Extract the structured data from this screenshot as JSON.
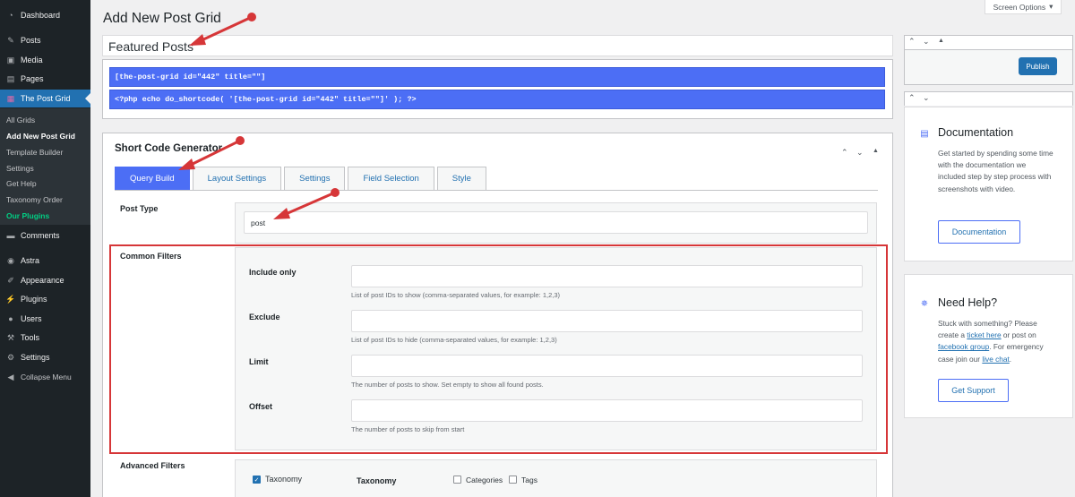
{
  "sidebar": {
    "items": [
      {
        "label": "Dashboard",
        "icon": "dashboard-icon"
      },
      {
        "label": "Posts",
        "icon": "pin-icon"
      },
      {
        "label": "Media",
        "icon": "media-icon"
      },
      {
        "label": "Pages",
        "icon": "page-icon"
      },
      {
        "label": "The Post Grid",
        "icon": "grid-icon"
      },
      {
        "label": "Comments",
        "icon": "comment-icon"
      },
      {
        "label": "Astra",
        "icon": "astra-icon"
      },
      {
        "label": "Appearance",
        "icon": "brush-icon"
      },
      {
        "label": "Plugins",
        "icon": "plug-icon"
      },
      {
        "label": "Users",
        "icon": "user-icon"
      },
      {
        "label": "Tools",
        "icon": "wrench-icon"
      },
      {
        "label": "Settings",
        "icon": "settings-icon"
      },
      {
        "label": "Collapse Menu",
        "icon": "collapse-icon"
      }
    ],
    "submenu": [
      "All Grids",
      "Add New Post Grid",
      "Template Builder",
      "Settings",
      "Get Help",
      "Taxonomy Order",
      "Our Plugins"
    ]
  },
  "page": {
    "title": "Add New Post Grid",
    "screen_options": "Screen Options",
    "post_title": "Featured Posts"
  },
  "shortcodes": [
    "[the-post-grid id=\"442\" title=\"\"]",
    "<?php echo do_shortcode( '[the-post-grid id=\"442\" title=\"\"]' ); ?>"
  ],
  "generator": {
    "title": "Short Code Generator",
    "tabs": [
      "Query Build",
      "Layout Settings",
      "Settings",
      "Field Selection",
      "Style"
    ],
    "post_type": {
      "label": "Post Type",
      "value": "post"
    },
    "common_filters": {
      "label": "Common Filters",
      "fields": [
        {
          "label": "Include only",
          "hint": "List of post IDs to show (comma-separated values, for example: 1,2,3)"
        },
        {
          "label": "Exclude",
          "hint": "List of post IDs to hide (comma-separated values, for example: 1,2,3)"
        },
        {
          "label": "Limit",
          "hint": "The number of posts to show. Set empty to show all found posts."
        },
        {
          "label": "Offset",
          "hint": "The number of posts to skip from start"
        }
      ]
    },
    "advanced_filters": {
      "label": "Advanced Filters",
      "taxonomy_checkbox": "Taxonomy",
      "taxonomy_label": "Taxonomy",
      "options": [
        "Categories",
        "Tags"
      ]
    }
  },
  "publish_box": {
    "button": "Publish"
  },
  "documentation": {
    "title": "Documentation",
    "text": "Get started by spending some time with the documentation we included step by step process with screenshots with video.",
    "button": "Documentation"
  },
  "help": {
    "title": "Need Help?",
    "text_1": "Stuck with something? Please create a ",
    "link_1": "ticket here",
    "text_2": " or post on ",
    "link_2": "facebook group",
    "text_3": ". For emergency case join our ",
    "link_3": "live chat",
    "text_4": ".",
    "button": "Get Support"
  },
  "colors": {
    "accent": "#4c6ef5",
    "wp_blue": "#2271b1",
    "annotation_red": "#d63638"
  }
}
